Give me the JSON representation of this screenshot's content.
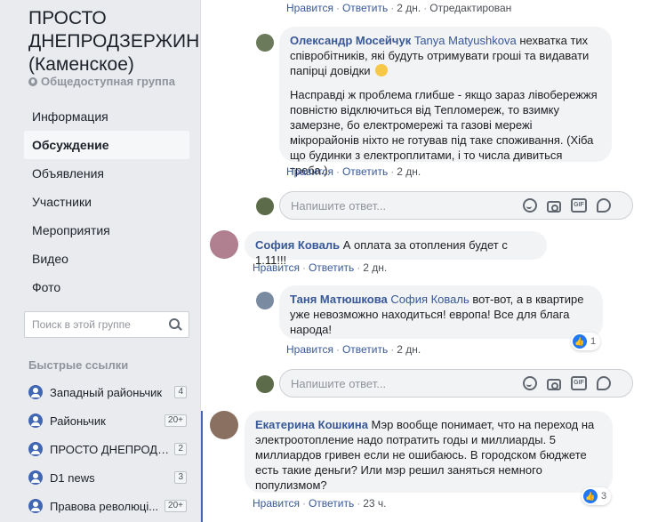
{
  "sidebar": {
    "group_title": "ПРОСТО ДНЕПРОДЗЕРЖИНСК (Каменское)",
    "group_type": "Общедоступная группа",
    "nav": [
      {
        "label": "Информация",
        "active": false
      },
      {
        "label": "Обсуждение",
        "active": true
      },
      {
        "label": "Объявления",
        "active": false
      },
      {
        "label": "Участники",
        "active": false
      },
      {
        "label": "Мероприятия",
        "active": false
      },
      {
        "label": "Видео",
        "active": false
      },
      {
        "label": "Фото",
        "active": false
      }
    ],
    "search_placeholder": "Поиск в этой группе",
    "quick_links_title": "Быстрые ссылки",
    "quick_links": [
      {
        "label": "Западный районьчик",
        "count": "4"
      },
      {
        "label": "Районьчик",
        "count": "20+"
      },
      {
        "label": "ПРОСТО ДНЕПРОДЗЕ...",
        "count": "2"
      },
      {
        "label": "D1 news",
        "count": "3"
      },
      {
        "label": "Правова революці...",
        "count": "20+"
      }
    ]
  },
  "top_actions": {
    "like": "Нравится",
    "reply": "Ответить",
    "time": "2 дн.",
    "edited": "Отредактирован"
  },
  "comments": [
    {
      "author": "Олександр Мосейчук",
      "mention": "Tanya Matyushkova",
      "text1": "нехватка тих співробітників, які будуть отримувати гроші та видавати папірці довідки",
      "text2": "Насправді ж проблема глибше - якщо зараз лівобережжя повністю відключиться від Тепломереж, то взимку замерзне, бо електромережі та газові мережі мікрорайонів ніхто не готував під таке споживання. (Хіба що будинки з електроплитами, і то числа дивиться треба.)",
      "like": "Нравится",
      "reply": "Ответить",
      "time": "2 дн."
    },
    {
      "author": "София Коваль",
      "text": "А оплата за отопления будет с 1.11!!!",
      "like": "Нравится",
      "reply": "Ответить",
      "time": "2 дн."
    },
    {
      "author": "Таня Матюшкова",
      "mention": "София Коваль",
      "text": "вот-вот, а в квартире уже невозможно находиться! европа! Все для блага народа!",
      "like": "Нравится",
      "reply": "Ответить",
      "time": "2 дн.",
      "likes": "1"
    },
    {
      "author": "Екатерина Кошкина",
      "text": "Мэр вообще понимает, что на переход на электроотопление надо потратить годы и миллиарды. 5 миллиардов гривен если не ошибаюсь. В городском бюджете есть такие деньги? Или мэр решил заняться немного популизмом?",
      "like": "Нравится",
      "reply": "Ответить",
      "time": "23 ч.",
      "likes": "3"
    }
  ],
  "reply_placeholder": "Напишите ответ...",
  "colors": {
    "link": "#385898",
    "accent": "#4267b2",
    "like": "#2078f4"
  }
}
